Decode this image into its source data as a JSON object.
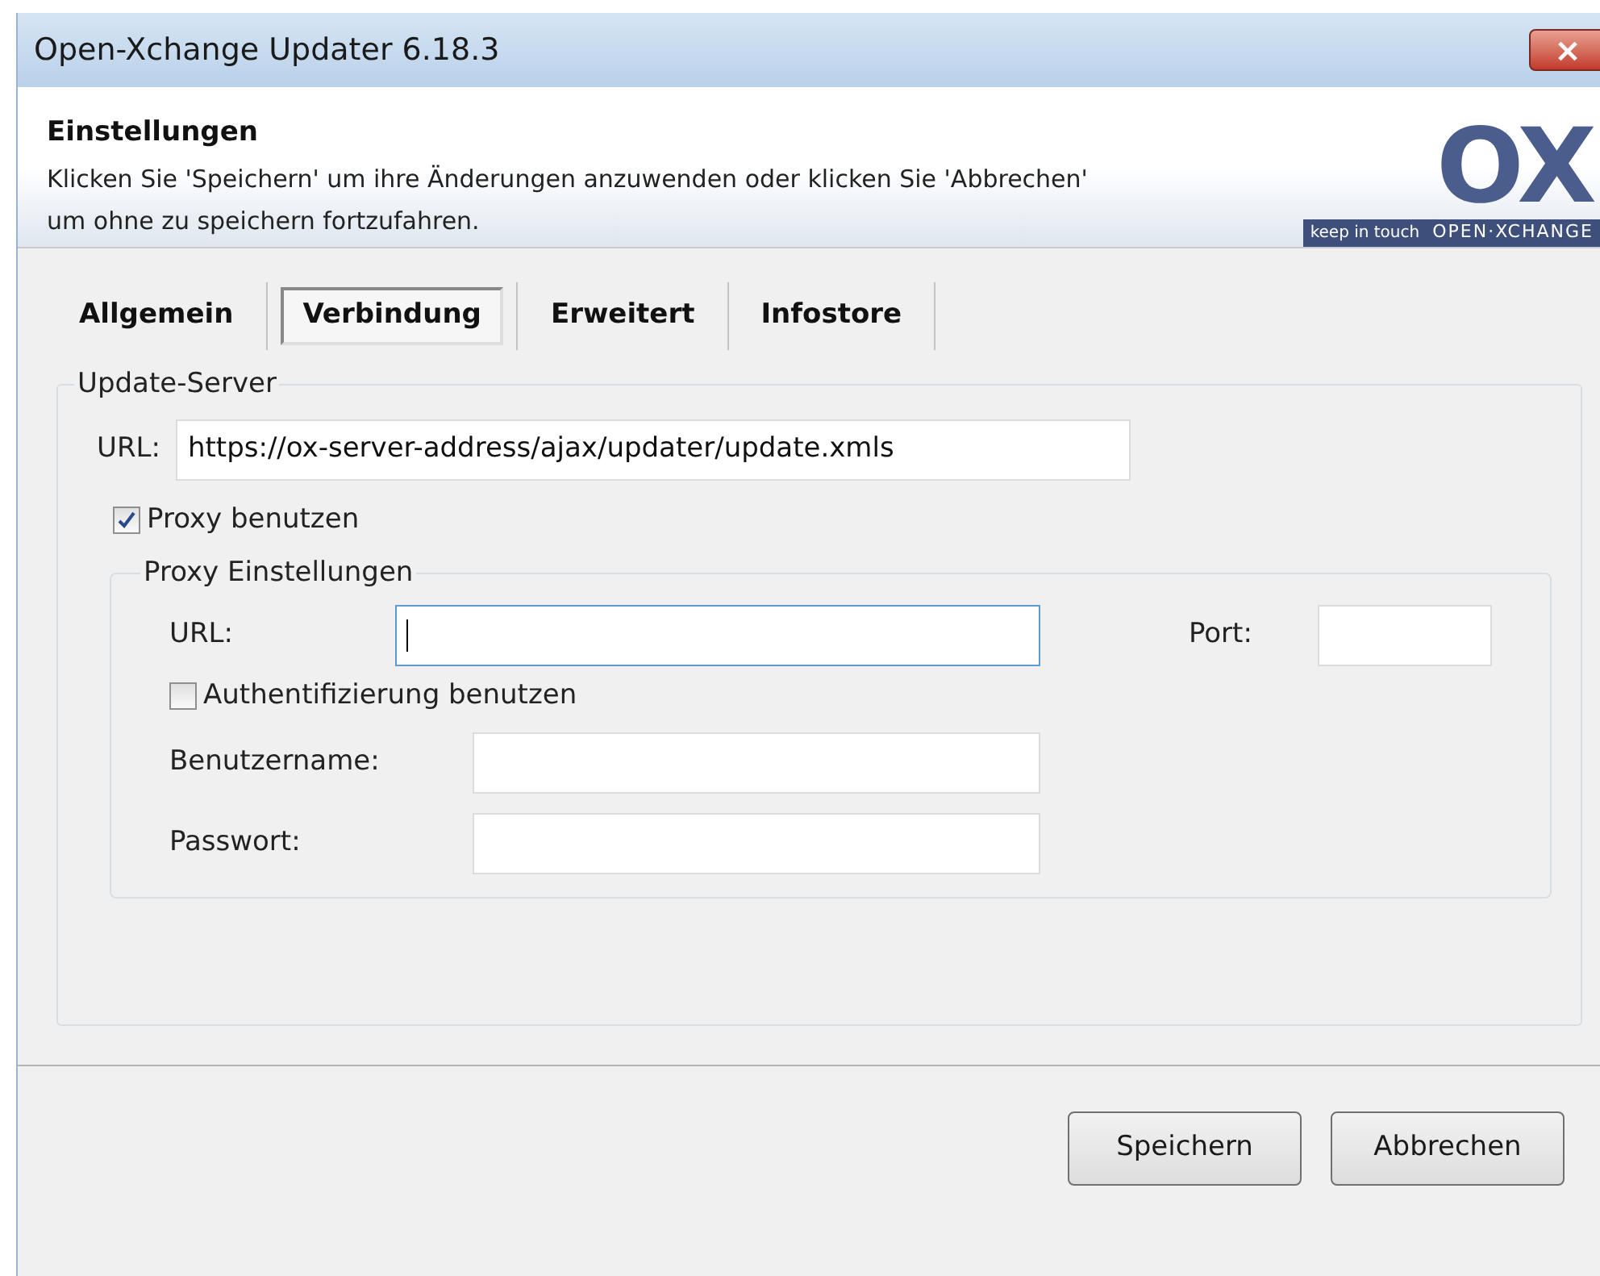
{
  "window": {
    "title": "Open-Xchange Updater 6.18.3",
    "close": "×"
  },
  "header": {
    "title": "Einstellungen",
    "description": "Klicken Sie 'Speichern' um ihre Änderungen anzuwenden oder klicken Sie 'Abbrechen' um ohne zu speichern fortzufahren.",
    "logo": {
      "mark": "OX",
      "tagline": "keep in touch",
      "brand": "OPEN·XCHANGE"
    }
  },
  "tabs": [
    {
      "label": "Allgemein",
      "selected": false
    },
    {
      "label": "Verbindung",
      "selected": true
    },
    {
      "label": "Erweitert",
      "selected": false
    },
    {
      "label": "Infostore",
      "selected": false
    }
  ],
  "update_server": {
    "legend": "Update-Server",
    "url_label": "URL:",
    "url_value": "https://ox-server-address/ajax/updater/update.xmls"
  },
  "use_proxy": {
    "label": "Proxy benutzen",
    "checked": true
  },
  "proxy_settings": {
    "legend": "Proxy Einstellungen",
    "url_label": "URL:",
    "port_label": "Port:",
    "use_auth": {
      "label": "Authentifizierung benutzen",
      "checked": false
    },
    "username_label": "Benutzername:",
    "password_label": "Passwort:"
  },
  "buttons": [
    "Speichern",
    "Abbrechen"
  ]
}
